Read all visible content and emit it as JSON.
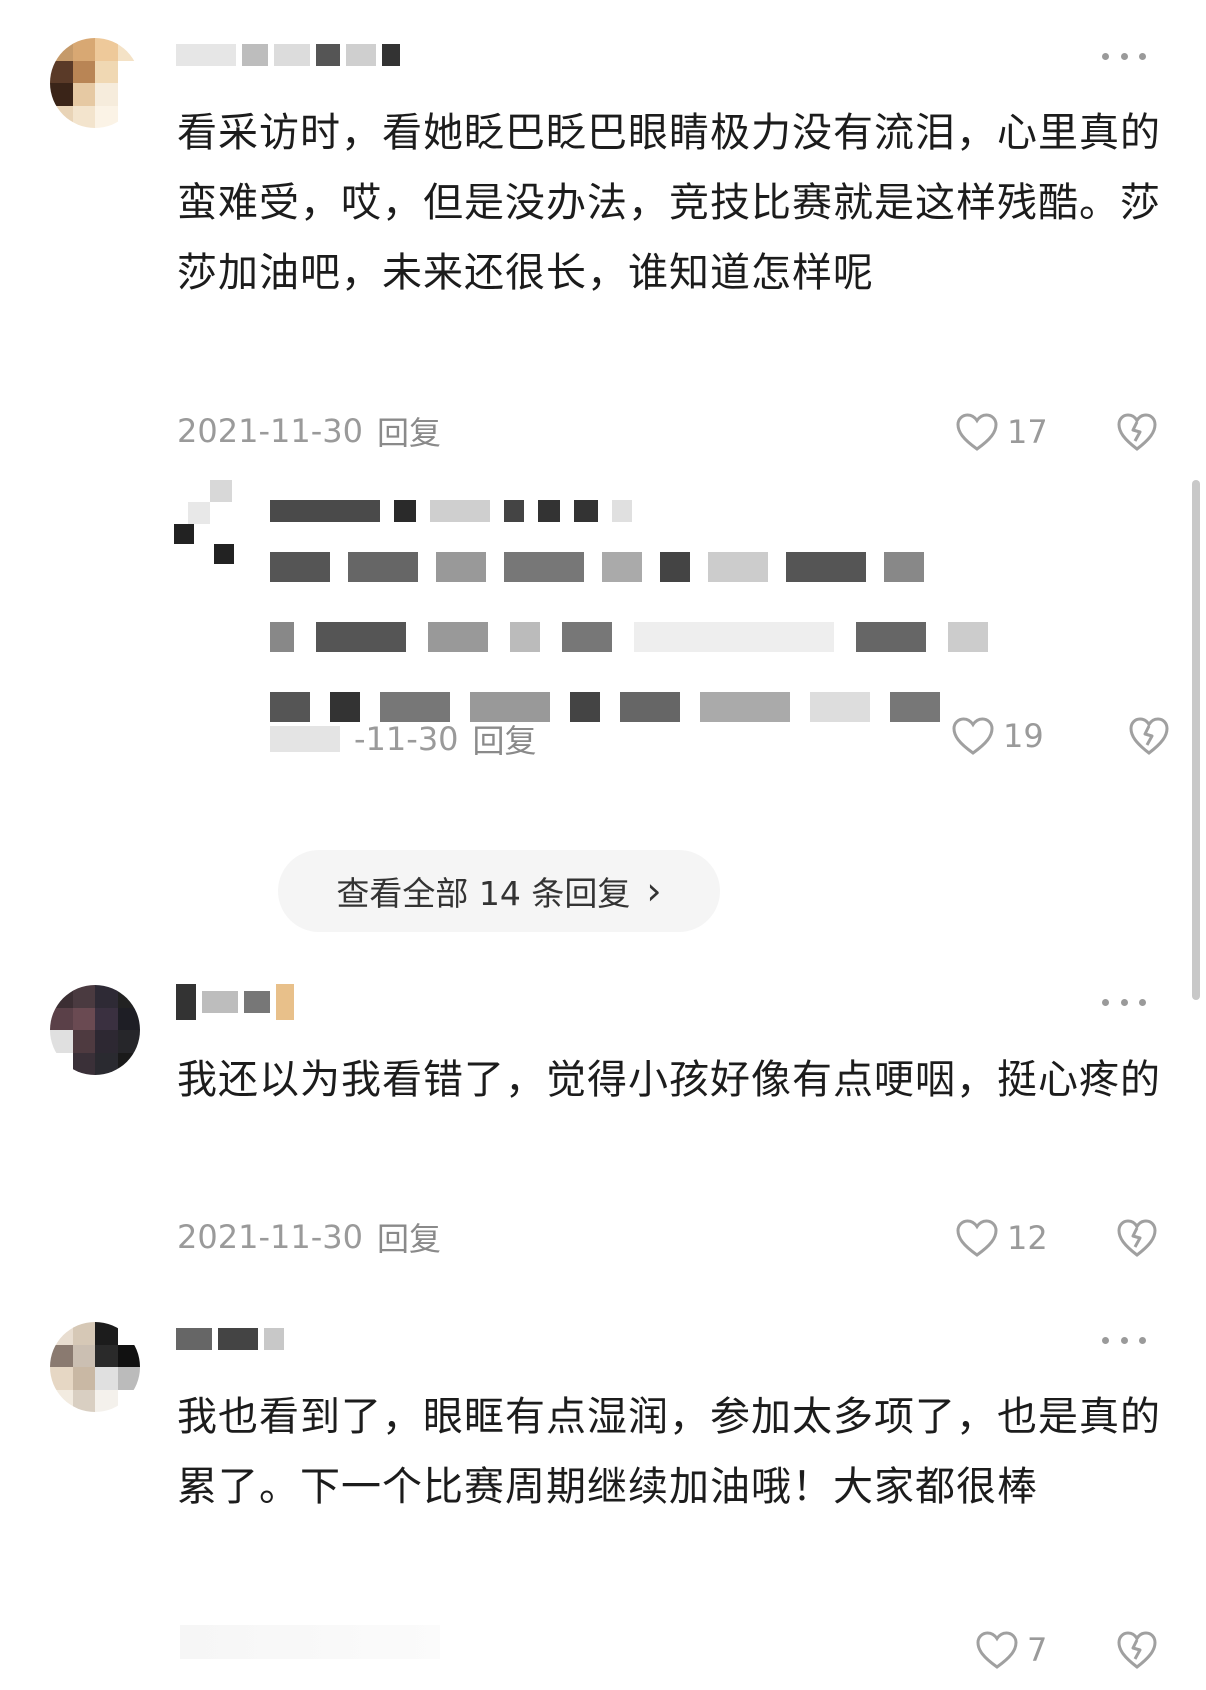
{
  "comments": [
    {
      "text": "看采访时，看她眨巴眨巴眼睛极力没有流泪，心里真的蛮难受，哎，但是没办法，竞技比赛就是这样残酷。莎莎加油吧，未来还很长，谁知道怎样呢",
      "date": "2021-11-30",
      "reply_label": "回复",
      "likes": "17"
    },
    {
      "text": "我还以为我看错了，觉得小孩好像有点哽咽，挺心疼的",
      "date": "2021-11-30",
      "reply_label": "回复",
      "likes": "12"
    },
    {
      "text": "我也看到了，眼眶有点湿润，参加太多项了，也是真的累了。下一个比赛周期继续加油哦！大家都很棒",
      "likes": "7"
    }
  ],
  "nested_reply": {
    "date_partial": "-11-30",
    "reply_label": "回复",
    "likes": "19"
  },
  "view_all": {
    "label": "查看全部 14 条回复",
    "chevron": "›"
  },
  "icons": {
    "like": "heart-outline-icon",
    "dislike": "broken-heart-icon",
    "more": "more-dots-icon"
  }
}
